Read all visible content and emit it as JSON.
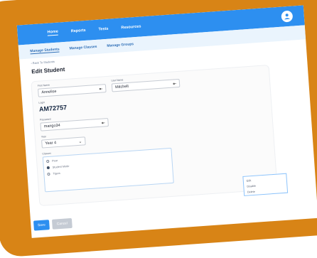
{
  "topbar": {
    "home": "Home",
    "reports": "Reports",
    "tests": "Tests",
    "resources": "Resources"
  },
  "subnav": {
    "manage_students": "Manage Students",
    "manage_classes": "Manage Classes",
    "manage_groups": "Manage Groups"
  },
  "page": {
    "back": "‹ Back To Students",
    "title": "Edit Student"
  },
  "form": {
    "first_name_label": "First Name",
    "first_name_value": "Annelise",
    "last_name_label": "Last Name",
    "last_name_value": "Mitchell",
    "login_label": "Login",
    "login_value": "AM72757",
    "password_label": "Password",
    "password_value": "mango34",
    "year_label": "Year",
    "year_value": "Year 4",
    "classes_label": "Classes",
    "classes": [
      {
        "label": "Pear",
        "checked": false
      },
      {
        "label": "Student Mode",
        "checked": true
      },
      {
        "label": "Tigers",
        "checked": false
      }
    ]
  },
  "context_menu": {
    "edit": "Edit",
    "disable": "Disable",
    "delete": "Delete"
  },
  "actions": {
    "save": "Save",
    "cancel": "Cancel"
  },
  "colors": {
    "accent": "#2d8ff0",
    "frame": "#d88416",
    "subbar": "#eaf4fd"
  }
}
